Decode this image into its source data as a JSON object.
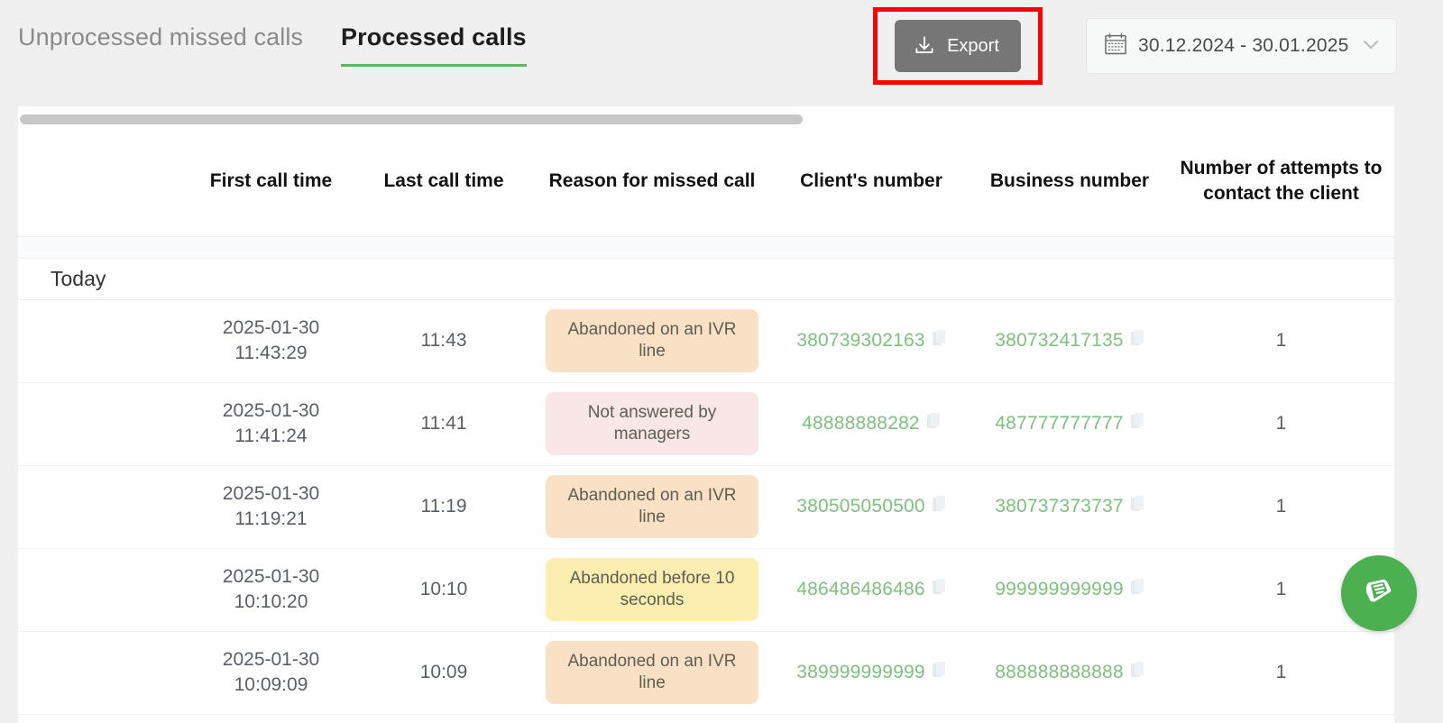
{
  "tabs": [
    {
      "label": "Unprocessed missed calls",
      "active": false
    },
    {
      "label": "Processed calls",
      "active": true
    }
  ],
  "toolbar": {
    "export_label": "Export",
    "export_icon": "download-icon",
    "highlight_color": "#ff0000",
    "export_bg": "#767676"
  },
  "date_range": {
    "value": "30.12.2024  -  30.01.2025",
    "start": "30.12.2024",
    "end": "30.01.2025",
    "separator": "-",
    "calendar_icon": "calendar-icon",
    "chevron_icon": "chevron-down-icon"
  },
  "table": {
    "headers": [
      "",
      "First call time",
      "Last call time",
      "Reason for missed call",
      "Client's number",
      "Business number",
      "Number of attempts to contact the client"
    ],
    "group_label": "Today",
    "copy_icon": "copy-icon",
    "rows": [
      {
        "first_call_time": "2025-01-30\n11:43:29",
        "last_call_time": "11:43",
        "reason": "Abandoned on an IVR line",
        "reason_type": "ivr",
        "reason_color": "#fae1c5",
        "client_number": "380739302163",
        "business_number": "380732417135",
        "attempts": "1"
      },
      {
        "first_call_time": "2025-01-30\n11:41:24",
        "last_call_time": "11:41",
        "reason": "Not answered by managers",
        "reason_type": "mgr",
        "reason_color": "#f9e7e7",
        "client_number": "48888888282",
        "business_number": "487777777777",
        "attempts": "1"
      },
      {
        "first_call_time": "2025-01-30\n11:19:21",
        "last_call_time": "11:19",
        "reason": "Abandoned on an IVR line",
        "reason_type": "ivr",
        "reason_color": "#fae1c5",
        "client_number": "380505050500",
        "business_number": "380737373737",
        "attempts": "1"
      },
      {
        "first_call_time": "2025-01-30\n10:10:20",
        "last_call_time": "10:10",
        "reason": "Abandoned before 10 seconds",
        "reason_type": "ten",
        "reason_color": "#fbeeb0",
        "client_number": "486486486486",
        "business_number": "999999999999",
        "attempts": "1"
      },
      {
        "first_call_time": "2025-01-30\n10:09:09",
        "last_call_time": "10:09",
        "reason": "Abandoned on an IVR line",
        "reason_type": "ivr",
        "reason_color": "#fae1c5",
        "client_number": "389999999999",
        "business_number": "888888888888",
        "attempts": "1"
      }
    ]
  },
  "fab": {
    "icon": "knowledge-base-book-icon",
    "color": "#4caf50"
  },
  "colors": {
    "accent_green": "#5cb85c",
    "link_green": "#7ec07e",
    "page_bg": "#f0f0f0",
    "card_bg": "#ffffff"
  }
}
